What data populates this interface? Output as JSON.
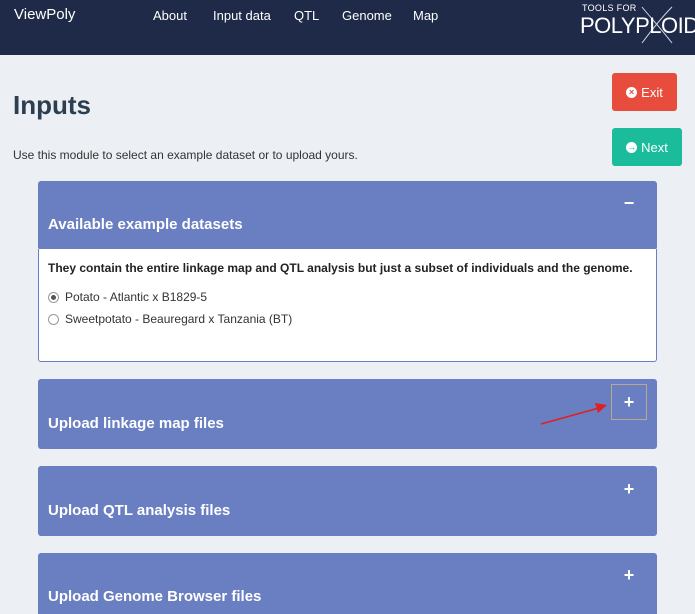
{
  "navbar": {
    "brand": "ViewPoly",
    "links": [
      "About",
      "Input data",
      "QTL",
      "Genome",
      "Map"
    ],
    "logo_small": "TOOLS FOR",
    "logo_big": "POLYPLOIDS"
  },
  "page": {
    "title": "Inputs",
    "subtitle": "Use this module to select an example dataset or to upload yours."
  },
  "buttons": {
    "exit": "Exit",
    "next": "Next"
  },
  "example_box": {
    "title": "Available example datasets",
    "tool": "−",
    "description": "They contain the entire linkage map and QTL analysis but just a subset of individuals and the genome.",
    "options": [
      {
        "label": "Potato - Atlantic x B1829-5",
        "selected": true
      },
      {
        "label": "Sweetpotato - Beauregard x Tanzania (BT)",
        "selected": false
      }
    ]
  },
  "upload_boxes": [
    {
      "title": "Upload linkage map files",
      "tool": "+"
    },
    {
      "title": "Upload QTL analysis files",
      "tool": "+"
    },
    {
      "title": "Upload Genome Browser files",
      "tool": "+"
    }
  ],
  "colors": {
    "navbar": "#1f2a48",
    "box_header": "#6a7fc1",
    "exit": "#e74c3c",
    "next": "#1abc9c",
    "annotation_arrow": "#e02020"
  }
}
